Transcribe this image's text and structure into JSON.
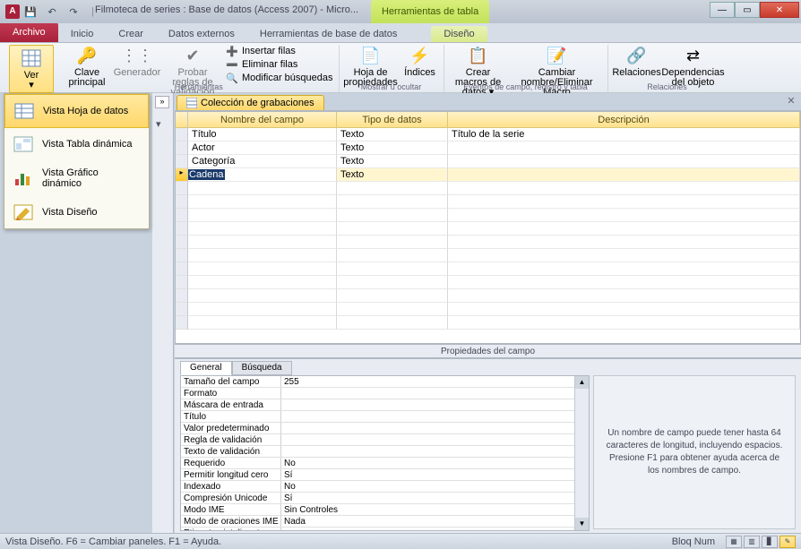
{
  "titlebar": {
    "app_letter": "A",
    "title": "Filmoteca de series : Base de datos (Access 2007) - Micro...",
    "tool_context": "Herramientas de tabla"
  },
  "ribbon_tabs": {
    "file": "Archivo",
    "items": [
      "Inicio",
      "Crear",
      "Datos externos",
      "Herramientas de base de datos"
    ],
    "context_tab": "Diseño"
  },
  "ribbon": {
    "ver": {
      "label": "Ver"
    },
    "clave": {
      "label": "Clave principal"
    },
    "generador": {
      "label": "Generador"
    },
    "probar": {
      "label": "Probar reglas de validación"
    },
    "insertar": "Insertar filas",
    "eliminar": "Eliminar filas",
    "modificar": "Modificar búsquedas",
    "group_tools": "Herramientas",
    "hoja": {
      "label": "Hoja de propiedades"
    },
    "indices": {
      "label": "Índices"
    },
    "group_show": "Mostrar u ocultar",
    "crear_macros": "Crear macros de datos ▾",
    "cambiar_macro": "Cambiar nombre/Eliminar Macro",
    "group_events": "Eventos de campo, registro y tabla",
    "relaciones": "Relaciones",
    "deps": "Dependencias del objeto",
    "group_rel": "Relaciones"
  },
  "view_menu": {
    "items": [
      "Vista Hoja de datos",
      "Vista Tabla dinámica",
      "Vista Gráfico dinámico",
      "Vista Diseño"
    ]
  },
  "doc_tab": "Colección de grabaciones",
  "grid": {
    "headers": [
      "Nombre del campo",
      "Tipo de datos",
      "Descripción"
    ],
    "rows": [
      {
        "name": "Título",
        "type": "Texto",
        "desc": "Título de la serie"
      },
      {
        "name": "Actor",
        "type": "Texto",
        "desc": ""
      },
      {
        "name": "Categoría",
        "type": "Texto",
        "desc": ""
      },
      {
        "name": "Cadena",
        "type": "Texto",
        "desc": ""
      }
    ]
  },
  "splitter": "Propiedades del campo",
  "prop_tabs": {
    "general": "General",
    "lookup": "Búsqueda"
  },
  "properties": [
    {
      "label": "Tamaño del campo",
      "value": "255"
    },
    {
      "label": "Formato",
      "value": ""
    },
    {
      "label": "Máscara de entrada",
      "value": ""
    },
    {
      "label": "Título",
      "value": ""
    },
    {
      "label": "Valor predeterminado",
      "value": ""
    },
    {
      "label": "Regla de validación",
      "value": ""
    },
    {
      "label": "Texto de validación",
      "value": ""
    },
    {
      "label": "Requerido",
      "value": "No"
    },
    {
      "label": "Permitir longitud cero",
      "value": "Sí"
    },
    {
      "label": "Indexado",
      "value": "No"
    },
    {
      "label": "Compresión Unicode",
      "value": "Sí"
    },
    {
      "label": "Modo IME",
      "value": "Sin Controles"
    },
    {
      "label": "Modo de oraciones IME",
      "value": "Nada"
    },
    {
      "label": "Etiquetas inteligentes",
      "value": ""
    }
  ],
  "help_text": "Un nombre de campo puede tener hasta 64 caracteres de longitud, incluyendo espacios. Presione F1 para obtener ayuda acerca de los nombres de campo.",
  "status": {
    "left": "Vista Diseño.   F6 = Cambiar paneles.   F1 = Ayuda.",
    "numlock": "Bloq Num"
  }
}
